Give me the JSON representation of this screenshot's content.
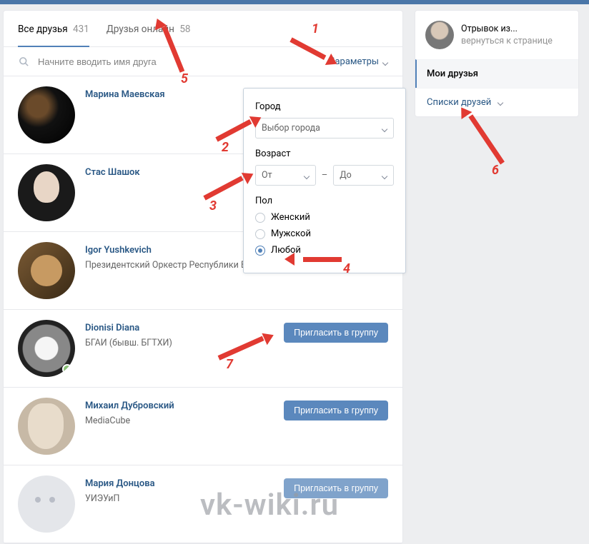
{
  "tabs": {
    "all_label": "Все друзья",
    "all_count": "431",
    "online_label": "Друзья онлайн",
    "online_count": "58"
  },
  "search": {
    "placeholder": "Начните вводить имя друга",
    "params_label": "Параметры"
  },
  "filters": {
    "city_label": "Город",
    "city_placeholder": "Выбор города",
    "age_label": "Возраст",
    "age_from": "От",
    "age_to": "До",
    "gender_label": "Пол",
    "gender_female": "Женский",
    "gender_male": "Мужской",
    "gender_any": "Любой"
  },
  "invite_label": "Пригласить в группу",
  "friends": [
    {
      "name": "Марина Маевская",
      "sub": ""
    },
    {
      "name": "Стас Шашок",
      "sub": ""
    },
    {
      "name": "Igor Yushkevich",
      "sub": "Президентский Оркестр Республики Беларусь"
    },
    {
      "name": "Dionisi Diana",
      "sub": "БГАИ (бывш. БГТХИ)"
    },
    {
      "name": "Михаил Дубровский",
      "sub": "MediaCube"
    },
    {
      "name": "Мария Донцова",
      "sub": "УИЭУиП"
    }
  ],
  "sidebar": {
    "profile_title": "Отрывок из...",
    "profile_back": "вернуться к странице",
    "my_friends": "Мои друзья",
    "friend_lists": "Списки друзей"
  },
  "annotations": {
    "a1": "1",
    "a2": "2",
    "a3": "3",
    "a4": "4",
    "a5": "5",
    "a6": "6",
    "a7": "7"
  },
  "watermark": "vk-wiki.ru"
}
